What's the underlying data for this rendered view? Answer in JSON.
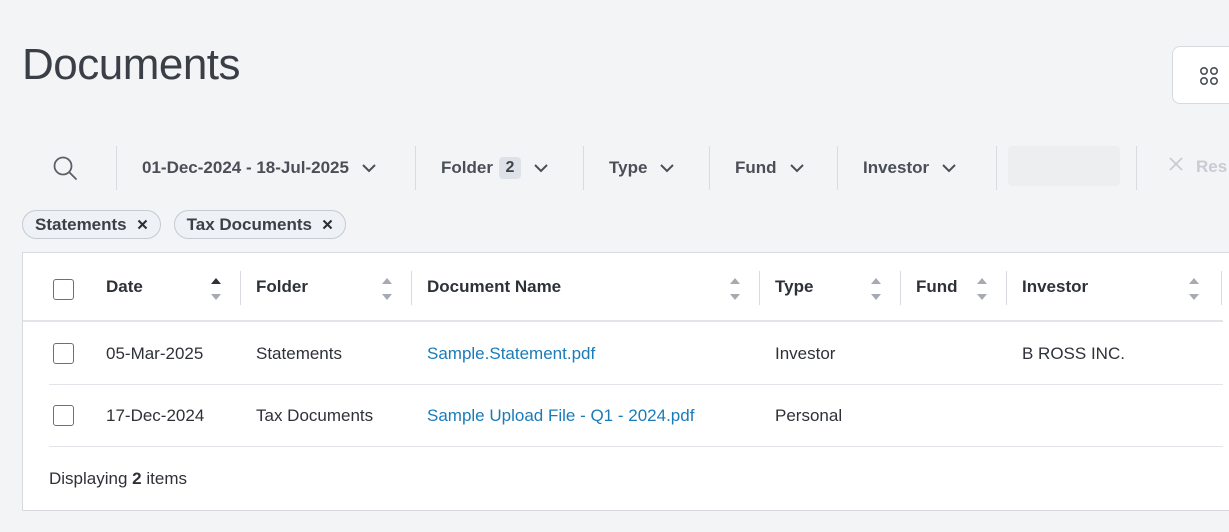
{
  "page": {
    "title": "Documents"
  },
  "filters": {
    "date_range": "01-Dec-2024 - 18-Jul-2025",
    "folder_label": "Folder",
    "folder_count": "2",
    "type_label": "Type",
    "fund_label": "Fund",
    "investor_label": "Investor",
    "reset_label": "Res"
  },
  "chips": [
    {
      "label": "Statements"
    },
    {
      "label": "Tax Documents"
    }
  ],
  "table": {
    "columns": [
      "Date",
      "Folder",
      "Document Name",
      "Type",
      "Fund",
      "Investor"
    ],
    "rows": [
      {
        "date": "05-Mar-2025",
        "folder": "Statements",
        "document": "Sample.Statement.pdf",
        "type": "Investor",
        "fund": "",
        "investor": "B ROSS INC."
      },
      {
        "date": "17-Dec-2024",
        "folder": "Tax Documents",
        "document": "Sample Upload File - Q1 - 2024.pdf",
        "type": "Personal",
        "fund": "",
        "investor": ""
      }
    ]
  },
  "footer": {
    "prefix": "Displaying",
    "count": "2",
    "suffix": "items"
  },
  "icons": {
    "search": "search-icon",
    "chevron": "chevron-down-icon",
    "close": "close-icon",
    "grid": "grid-view-icon",
    "sort": "sort-icon",
    "sort_asc": "sort-ascending-icon"
  },
  "colors": {
    "link": "#1a7bb9",
    "background": "#f3f4f6"
  }
}
